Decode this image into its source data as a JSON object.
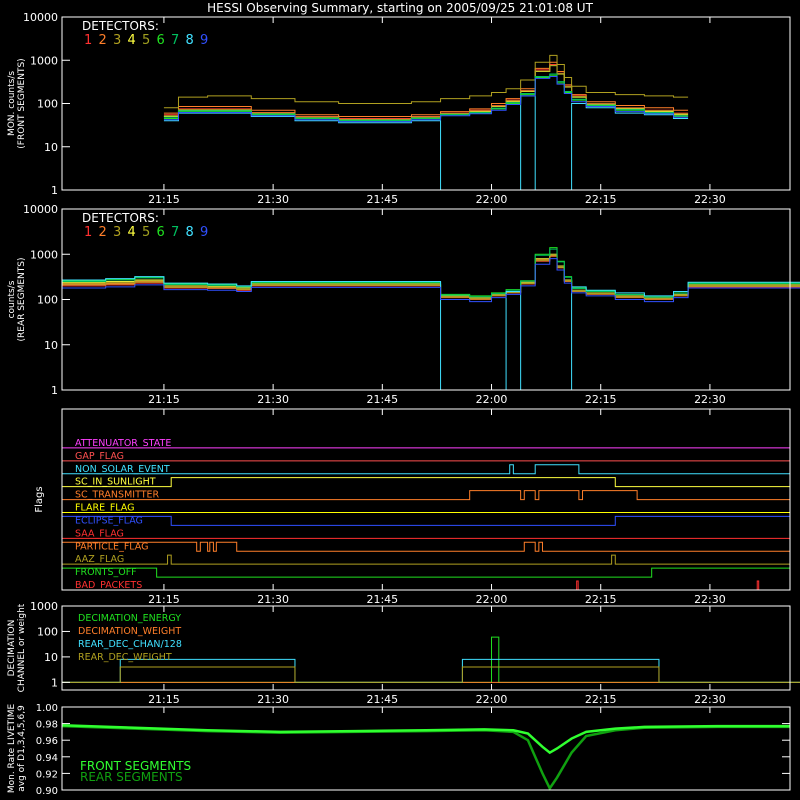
{
  "title": "HESSI Observing Summary, starting on 2005/09/25 21:01:08 UT",
  "time_ticks": [
    "21:15",
    "21:30",
    "21:45",
    "22:00",
    "22:15",
    "22:30"
  ],
  "time_tick_minutes": [
    14,
    29,
    44,
    59,
    74,
    89
  ],
  "time_range_minutes": [
    0,
    100
  ],
  "detector_colors": [
    "#ff3030",
    "#ff7f2a",
    "#b0a020",
    "#ffff40",
    "#a0a020",
    "#20e020",
    "#00c060",
    "#40e0ff",
    "#3050ff"
  ],
  "chart_data": [
    {
      "type": "line",
      "id": "front",
      "ylabel": "MON. counts/s (FRONT SEGMENTS)",
      "ylabel_lines": [
        "MON. counts/s",
        "(FRONT SEGMENTS)"
      ],
      "legend_title": "DETECTORS:",
      "legend_entries": [
        "1",
        "2",
        "3",
        "4",
        "5",
        "6",
        "7",
        "8",
        "9"
      ],
      "yscale": "log",
      "ylim": [
        1,
        10000
      ],
      "ytick_labels": [
        "1",
        "10",
        "100",
        "1000",
        "10000"
      ],
      "x": [
        14,
        16,
        20,
        26,
        32,
        38,
        44,
        48,
        52,
        56,
        59,
        61,
        63,
        65,
        67,
        68,
        69,
        70,
        72,
        76,
        80,
        84
      ],
      "series": [
        {
          "values": [
            55,
            75,
            75,
            62,
            50,
            45,
            45,
            50,
            60,
            70,
            90,
            120,
            200,
            600,
            800,
            500,
            250,
            150,
            100,
            80,
            70,
            60
          ]
        },
        {
          "values": [
            60,
            85,
            85,
            70,
            55,
            50,
            50,
            55,
            65,
            75,
            100,
            130,
            220,
            650,
            900,
            550,
            270,
            160,
            110,
            90,
            80,
            70
          ]
        },
        {
          "values": [
            80,
            140,
            150,
            130,
            110,
            100,
            100,
            110,
            130,
            150,
            180,
            220,
            350,
            900,
            1300,
            800,
            400,
            250,
            180,
            160,
            150,
            140
          ]
        },
        {
          "values": [
            50,
            70,
            70,
            60,
            48,
            42,
            42,
            48,
            58,
            65,
            85,
            110,
            190,
            550,
            750,
            480,
            240,
            140,
            95,
            75,
            65,
            55
          ]
        },
        {
          "values": [
            52,
            72,
            72,
            60,
            48,
            43,
            43,
            48,
            58,
            67,
            87,
            115,
            195,
            560,
            760,
            490,
            245,
            145,
            98,
            78,
            68,
            58
          ]
        },
        {
          "values": [
            45,
            65,
            65,
            55,
            45,
            40,
            40,
            45,
            55,
            60,
            75,
            100,
            160,
            400,
            450,
            300,
            180,
            120,
            90,
            70,
            60,
            50
          ]
        },
        {
          "values": [
            48,
            68,
            68,
            57,
            46,
            41,
            41,
            46,
            56,
            62,
            78,
            105,
            170,
            420,
            480,
            320,
            190,
            125,
            92,
            72,
            62,
            52
          ]
        },
        {
          "values": [
            40,
            60,
            60,
            50,
            40,
            36,
            36,
            40,
            1,
            1,
            1,
            1,
            150,
            1,
            1,
            1,
            1,
            100,
            80,
            60,
            55,
            45
          ]
        },
        {
          "values": [
            42,
            62,
            62,
            52,
            42,
            38,
            38,
            42,
            52,
            58,
            70,
            95,
            150,
            380,
            420,
            280,
            170,
            110,
            85,
            65,
            58,
            48
          ]
        }
      ]
    },
    {
      "type": "line",
      "id": "rear",
      "ylabel": "counts/s (REAR SEGMENTS)",
      "ylabel_lines": [
        "counts/s",
        "(REAR SEGMENTS)"
      ],
      "legend_title": "DETECTORS:",
      "legend_entries": [
        "1",
        "2",
        "3",
        "4",
        "5",
        "6",
        "7",
        "8",
        "9"
      ],
      "yscale": "log",
      "ylim": [
        1,
        10000
      ],
      "ytick_labels": [
        "1",
        "10",
        "100",
        "1000",
        "10000"
      ],
      "x": [
        0,
        6,
        10,
        14,
        20,
        24,
        26,
        32,
        38,
        44,
        50,
        52,
        56,
        59,
        61,
        63,
        65,
        67,
        68,
        69,
        70,
        72,
        76,
        80,
        84,
        86,
        92,
        100
      ],
      "series": [
        {
          "values": [
            200,
            210,
            230,
            180,
            175,
            160,
            200,
            200,
            200,
            200,
            200,
            110,
            100,
            120,
            140,
            220,
            700,
            900,
            500,
            250,
            150,
            130,
            110,
            100,
            120,
            190,
            190,
            190
          ]
        },
        {
          "values": [
            220,
            230,
            250,
            190,
            185,
            170,
            210,
            210,
            210,
            210,
            210,
            115,
            105,
            125,
            145,
            230,
            750,
            950,
            520,
            260,
            155,
            135,
            115,
            105,
            125,
            200,
            200,
            200
          ]
        },
        {
          "values": [
            210,
            220,
            240,
            185,
            180,
            165,
            205,
            205,
            205,
            205,
            205,
            112,
            102,
            122,
            142,
            225,
            720,
            920,
            510,
            255,
            152,
            132,
            112,
            102,
            122,
            195,
            195,
            195
          ]
        },
        {
          "values": [
            240,
            250,
            270,
            200,
            195,
            180,
            220,
            220,
            220,
            220,
            220,
            120,
            110,
            130,
            150,
            240,
            800,
            1000,
            550,
            270,
            160,
            140,
            120,
            110,
            130,
            210,
            210,
            210
          ]
        },
        {
          "values": [
            230,
            240,
            260,
            195,
            190,
            175,
            215,
            215,
            215,
            215,
            215,
            118,
            108,
            128,
            148,
            235,
            780,
            980,
            540,
            265,
            158,
            138,
            118,
            108,
            128,
            205,
            205,
            205
          ]
        },
        {
          "values": [
            260,
            280,
            310,
            220,
            210,
            195,
            240,
            240,
            240,
            240,
            240,
            130,
            120,
            140,
            165,
            260,
            1000,
            1400,
            700,
            320,
            180,
            155,
            130,
            115,
            140,
            230,
            230,
            230
          ]
        },
        {
          "values": [
            250,
            270,
            300,
            215,
            205,
            190,
            235,
            235,
            235,
            235,
            235,
            125,
            115,
            135,
            160,
            255,
            950,
            1300,
            680,
            310,
            175,
            150,
            128,
            113,
            138,
            225,
            225,
            225
          ]
        },
        {
          "values": [
            270,
            290,
            320,
            230,
            220,
            200,
            250,
            250,
            250,
            250,
            250,
            1,
            1,
            1,
            150,
            1,
            1,
            1,
            1,
            1,
            190,
            160,
            140,
            120,
            150,
            240,
            240,
            240
          ]
        },
        {
          "values": [
            180,
            190,
            210,
            165,
            160,
            150,
            185,
            185,
            185,
            185,
            185,
            100,
            90,
            110,
            130,
            200,
            600,
            800,
            450,
            230,
            140,
            120,
            100,
            90,
            110,
            180,
            180,
            180
          ]
        }
      ]
    },
    {
      "type": "line",
      "id": "flags",
      "ylabel": "Flags",
      "legend_entries": [
        "ATTENUATOR_STATE",
        "GAP_FLAG",
        "NON_SOLAR_EVENT",
        "SC_IN_SUNLIGHT",
        "SC_TRANSMITTER",
        "FLARE_FLAG",
        "ECLIPSE_FLAG",
        "SAA_FLAG",
        "PARTICLE_FLAG",
        "AAZ_FLAG",
        "FRONTS_OFF",
        "BAD_PACKETS"
      ],
      "series": [
        {
          "name": "ATTENUATOR_STATE",
          "color": "#ff40ff",
          "segments": []
        },
        {
          "name": "GAP_FLAG",
          "color": "#ff5050",
          "segments": []
        },
        {
          "name": "NON_SOLAR_EVENT",
          "color": "#40e0ff",
          "segments": [
            [
              61.5,
              62
            ],
            [
              65,
              71
            ]
          ]
        },
        {
          "name": "SC_IN_SUNLIGHT",
          "color": "#ffff40",
          "segments": [
            [
              15,
              76
            ]
          ]
        },
        {
          "name": "SC_TRANSMITTER",
          "color": "#ff7f2a",
          "segments": [
            [
              56,
              63
            ],
            [
              63.5,
              65
            ],
            [
              65.5,
              71
            ],
            [
              71.5,
              79
            ]
          ]
        },
        {
          "name": "FLARE_FLAG",
          "color": "#ffff00",
          "segments": []
        },
        {
          "name": "ECLIPSE_FLAG",
          "color": "#3050ff",
          "segments": [
            [
              0,
              15
            ],
            [
              76,
              100
            ]
          ]
        },
        {
          "name": "SAA_FLAG",
          "color": "#ff3030",
          "segments": []
        },
        {
          "name": "PARTICLE_FLAG",
          "color": "#ff7f2a",
          "segments": [
            [
              0,
              18.5
            ],
            [
              19,
              20
            ],
            [
              20.3,
              20.8
            ],
            [
              21.2,
              24
            ],
            [
              63.5,
              65
            ],
            [
              65.5,
              66
            ]
          ]
        },
        {
          "name": "AAZ_FLAG",
          "color": "#b0a020",
          "segments": [
            [
              14.5,
              15
            ],
            [
              75.5,
              76
            ]
          ]
        },
        {
          "name": "FRONTS_OFF",
          "color": "#20e020",
          "segments": [
            [
              0,
              13
            ],
            [
              81,
              100
            ]
          ]
        },
        {
          "name": "BAD_PACKETS",
          "color": "#ff3030",
          "segments": [
            [
              70.7,
              70.9
            ],
            [
              95.5,
              95.7
            ]
          ]
        }
      ]
    },
    {
      "type": "line",
      "id": "decimation",
      "ylabel": "DECIMATION CHANNEL or weight",
      "ylabel_lines": [
        "DECIMATION",
        "CHANNEL or weight"
      ],
      "legend_entries": [
        "DECIMATION_ENERGY",
        "DECIMATION_WEIGHT",
        "REAR_DEC_CHAN/128",
        "REAR_DEC_WEIGHT"
      ],
      "yscale": "log",
      "ylim": [
        0.5,
        1000
      ],
      "ytick_labels": [
        "1",
        "10",
        "100",
        "1000"
      ],
      "x": [
        0,
        8,
        32,
        55,
        59,
        60,
        82,
        100
      ],
      "series": [
        {
          "name": "DECIMATION_ENERGY",
          "color": "#20e020",
          "values": [
            1,
            1,
            1,
            1,
            60,
            1,
            1,
            1
          ]
        },
        {
          "name": "DECIMATION_WEIGHT",
          "color": "#ff7f2a",
          "values": [
            1,
            1,
            1,
            1,
            1,
            1,
            1,
            1
          ]
        },
        {
          "name": "REAR_DEC_CHAN/128",
          "color": "#40e0ff",
          "values": [
            1,
            8,
            1,
            8,
            8,
            8,
            1,
            1
          ]
        },
        {
          "name": "REAR_DEC_WEIGHT",
          "color": "#b0a020",
          "values": [
            1,
            4,
            1,
            4,
            4,
            4,
            1,
            1
          ]
        }
      ]
    },
    {
      "type": "line",
      "id": "livetime",
      "ylabel": "Mon. Rate LIVETIME avg of D1,3,4,5,6,9",
      "ylabel_lines": [
        "Mon. Rate LIVETIME",
        "avg of D1,3,4,5,6,9"
      ],
      "legend_entries": [
        "FRONT SEGMENTS",
        "REAR SEGMENTS"
      ],
      "ylim": [
        0.9,
        1.0
      ],
      "ytick_labels": [
        "0.90",
        "0.92",
        "0.94",
        "0.96",
        "0.98",
        "1.00"
      ],
      "x": [
        0,
        10,
        20,
        30,
        40,
        50,
        58,
        62,
        64,
        66,
        67,
        68,
        70,
        72,
        76,
        80,
        90,
        100
      ],
      "series": [
        {
          "name": "FRONT SEGMENTS",
          "color": "#30ff30",
          "values": [
            0.978,
            0.975,
            0.972,
            0.97,
            0.971,
            0.972,
            0.973,
            0.972,
            0.968,
            0.952,
            0.945,
            0.95,
            0.962,
            0.97,
            0.974,
            0.976,
            0.977,
            0.977
          ]
        },
        {
          "name": "REAR SEGMENTS",
          "color": "#10a010",
          "values": [
            0.977,
            0.974,
            0.971,
            0.969,
            0.97,
            0.971,
            0.972,
            0.97,
            0.96,
            0.92,
            0.902,
            0.915,
            0.945,
            0.965,
            0.972,
            0.975,
            0.976,
            0.976
          ]
        }
      ]
    }
  ]
}
